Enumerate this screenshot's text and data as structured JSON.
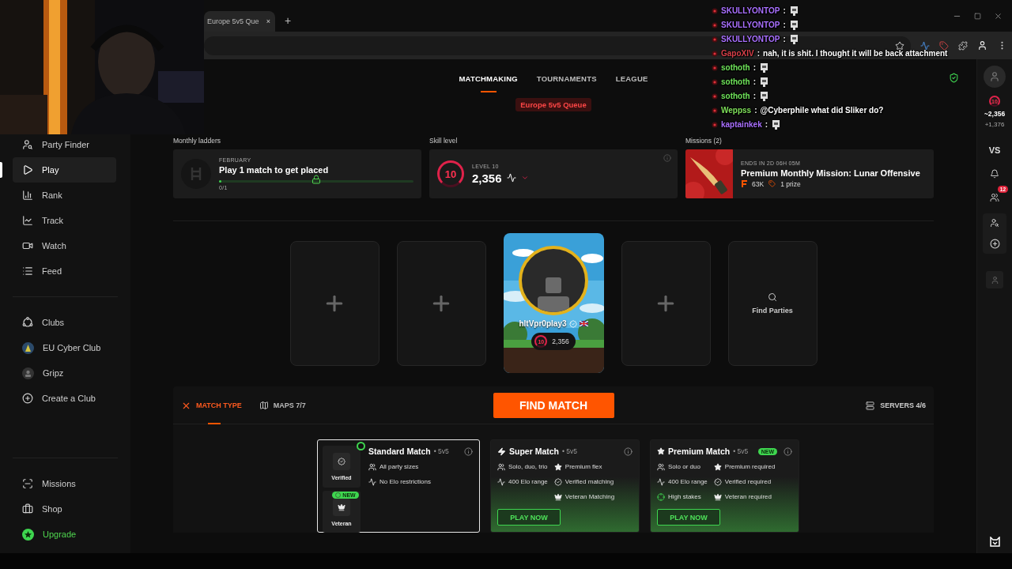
{
  "browser": {
    "tab_title": "Europe 5v5 Que",
    "tab_close": "×",
    "new_tab": "+"
  },
  "chat": [
    {
      "user": "SKULLYONTOP",
      "color": "#a970ff",
      "separator": ":",
      "kind": "emote"
    },
    {
      "user": "SKULLYONTOP",
      "color": "#a970ff",
      "separator": ":",
      "kind": "emote"
    },
    {
      "user": "SKULLYONTOP",
      "color": "#a970ff",
      "separator": ":",
      "kind": "emote"
    },
    {
      "user": "GapoXIV",
      "color": "#d8404a",
      "separator": ":",
      "kind": "text",
      "message": "nah, it is shit. I thought it will be back attachment"
    },
    {
      "user": "sothoth",
      "color": "#6fe35a",
      "separator": ":",
      "kind": "emote"
    },
    {
      "user": "sothoth",
      "color": "#6fe35a",
      "separator": ":",
      "kind": "emote"
    },
    {
      "user": "sothoth",
      "color": "#6fe35a",
      "separator": ":",
      "kind": "emote"
    },
    {
      "user": "Weppss",
      "color": "#7fe05a",
      "separator": ":",
      "kind": "text",
      "message": "@Cyberphile what did Sliker do?"
    },
    {
      "user": "kaptainkek",
      "color": "#a970ff",
      "separator": ":",
      "kind": "emote"
    }
  ],
  "sidebar": {
    "main": [
      {
        "label": "Party Finder",
        "selected": false
      },
      {
        "label": "Play",
        "selected": true
      },
      {
        "label": "Rank",
        "selected": false
      },
      {
        "label": "Track",
        "selected": false
      },
      {
        "label": "Watch",
        "selected": false
      },
      {
        "label": "Feed",
        "selected": false
      }
    ],
    "clubs": [
      {
        "label": "Clubs",
        "selected": false
      },
      {
        "label": "EU Cyber Club",
        "selected": false
      },
      {
        "label": "Gripz",
        "selected": false
      },
      {
        "label": "Create a Club",
        "selected": false
      }
    ],
    "bottom": [
      {
        "label": "Missions",
        "selected": false,
        "accent": false
      },
      {
        "label": "Shop",
        "selected": false,
        "accent": false
      },
      {
        "label": "Upgrade",
        "selected": false,
        "accent": true
      }
    ]
  },
  "nav": {
    "tabs": [
      {
        "label": "MATCHMAKING",
        "selected": true
      },
      {
        "label": "TOURNAMENTS",
        "selected": false
      },
      {
        "label": "LEAGUE",
        "selected": false
      }
    ]
  },
  "queue_badge": "Europe 5v5 Queue",
  "ladder": {
    "heading": "Monthly ladders",
    "month": "FEBRUARY",
    "title": "Play 1 match to get placed",
    "progress": "0/1",
    "level": 0
  },
  "skill": {
    "heading": "Skill level",
    "level_label": "LEVEL 10",
    "badge": "10",
    "elo": "2,356"
  },
  "missions": {
    "heading": "Missions (2)",
    "ends": "ENDS IN 2D 06H 05M",
    "title": "Premium Monthly Mission: Lunar Offensive",
    "points": "63K",
    "prize": "1 prize"
  },
  "party": [
    {
      "kind": "empty"
    },
    {
      "kind": "empty"
    },
    {
      "kind": "player",
      "name": "hltVpr0play3",
      "level": "10",
      "elo": "2,356"
    },
    {
      "kind": "empty"
    },
    {
      "kind": "find",
      "label": "Find Parties"
    }
  ],
  "toolbar": {
    "tabs": [
      {
        "label": "MATCH TYPE",
        "selected": true
      },
      {
        "label": "MAPS 7/7",
        "selected": false
      }
    ],
    "find_button": "FIND MATCH",
    "servers": "SERVERS 4/6"
  },
  "match_types": [
    {
      "kind": "standard",
      "title": "Standard Match",
      "format": "• 5v5",
      "selected": true,
      "tiers": [
        {
          "kind": "verified",
          "label": "Verified",
          "active": true
        },
        {
          "kind": "veteran",
          "label": "Veteran",
          "active": false,
          "badge": "NEW"
        }
      ],
      "columns": [
        [
          {
            "kind": "party",
            "text": "All party sizes"
          },
          {
            "kind": "elo",
            "text": "No Elo restrictions"
          }
        ]
      ]
    },
    {
      "kind": "super",
      "title": "Super Match",
      "format": "• 5v5",
      "selected": false,
      "columns": [
        [
          {
            "kind": "party",
            "text": "Solo, duo, trio"
          },
          {
            "kind": "elo",
            "text": "400 Elo range"
          }
        ],
        [
          {
            "kind": "premium",
            "text": "Premium flex"
          },
          {
            "kind": "verified",
            "text": "Verified matching"
          },
          {
            "kind": "veteran",
            "text": "Veteran Matching"
          }
        ]
      ],
      "button": "PLAY NOW"
    },
    {
      "kind": "premium",
      "title": "Premium Match",
      "format": "• 5v5",
      "selected": false,
      "badge": "NEW",
      "columns": [
        [
          {
            "kind": "party",
            "text": "Solo or duo"
          },
          {
            "kind": "elo",
            "text": "400 Elo range"
          },
          {
            "kind": "stakes",
            "text": "High stakes"
          }
        ],
        [
          {
            "kind": "premium",
            "text": "Premium required"
          },
          {
            "kind": "verified",
            "text": "Verified required"
          },
          {
            "kind": "veteran",
            "text": "Veteran required"
          }
        ]
      ],
      "button": "PLAY NOW"
    }
  ],
  "rail": {
    "level_badge": "10",
    "elo": "~2,356",
    "delta": "+1,376",
    "vs": "VS",
    "friends_badge": "12"
  }
}
